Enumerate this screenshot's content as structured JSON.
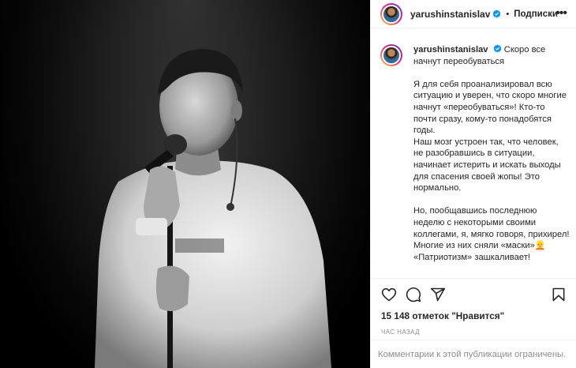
{
  "post": {
    "username": "yarushinstanislav",
    "follow_label": "Подписки",
    "dot": "•",
    "more_label": "•••"
  },
  "caption": {
    "username": "yarushinstanislav",
    "paragraphs": [
      "Скоро все начнут переобуваться",
      "Я для себя проанализировал всю ситуацию и уверен, что скоро многие начнут «переобуваться»! Кто-то почти сразу, кому-то понадобятся годы.",
      "Наш мозг устроен так, что человек, не разобравшись в ситуации, начинает истерить и искать выходы для спасения своей жопы! Это нормально.",
      "Но, пообщавшись последнюю неделю с некоторыми своими коллегами, я, мягко говоря, прихирел! Многие из них сняли «маски»👱",
      "«Патриотизм» зашкаливает!"
    ]
  },
  "actions": {
    "icons": [
      "heart-icon",
      "comment-icon",
      "share-icon",
      "bookmark-icon"
    ]
  },
  "likes": "15 148 отметок \"Нравится\"",
  "time": "час назад",
  "comments_notice": "Комментарии к этой публикации ограничены.",
  "colors": {
    "text": "#262626",
    "muted": "#8e8e8e",
    "verified": "#0095f6",
    "border": "#efefef"
  }
}
